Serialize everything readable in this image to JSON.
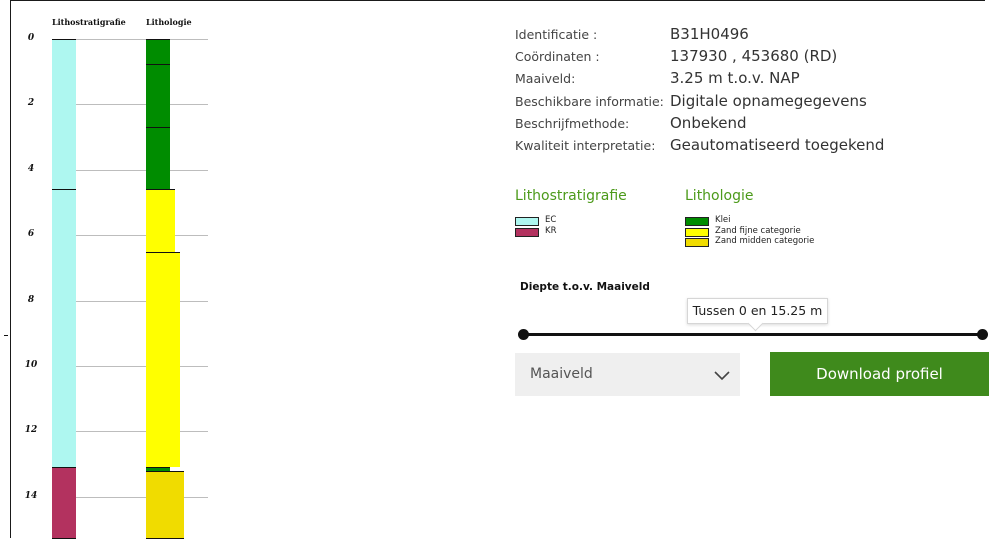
{
  "profile": {
    "columns": {
      "lithostratigrafie": "Lithostratigrafie",
      "lithologie": "Lithologie"
    },
    "depth_labels": [
      "0",
      "2",
      "4",
      "6",
      "8",
      "10",
      "12",
      "14"
    ],
    "unit_depth_range": [
      0,
      15.25
    ],
    "lithostratigrafie_layers": [
      {
        "code": "EC",
        "top": 0,
        "bottom": 4.6,
        "color": "#aef7f0"
      },
      {
        "code": "KR",
        "top": 13.1,
        "bottom": 15.25,
        "color": "#b3325f"
      }
    ],
    "lithologie_layers": [
      {
        "type": "Klei",
        "top": 0,
        "bottom": 4.6,
        "color": "#008c00"
      },
      {
        "type": "Zand fijne categorie",
        "top": 4.6,
        "bottom": 6.5,
        "color": "#ffff00"
      },
      {
        "type": "Zand fijne categorie",
        "top": 6.5,
        "bottom": 13.1,
        "color": "#ffff00"
      },
      {
        "type": "Klei",
        "top": 13.1,
        "bottom": 13.2,
        "color": "#008c00"
      },
      {
        "type": "Zand midden categorie",
        "top": 13.2,
        "bottom": 15.25,
        "color": "#f0dc00"
      }
    ]
  },
  "info": {
    "rows": [
      {
        "label": "Identificatie :",
        "value": "B31H0496"
      },
      {
        "label": "Coördinaten :",
        "value": "137930 , 453680 (RD)"
      },
      {
        "label": "Maaiveld:",
        "value": "3.25 m t.o.v. NAP"
      },
      {
        "label": "Beschikbare informatie:",
        "value": "Digitale opnamegegevens"
      },
      {
        "label": "Beschrijfmethode:",
        "value": "Onbekend"
      },
      {
        "label": "Kwaliteit interpretatie:",
        "value": "Geautomatiseerd toegekend"
      }
    ]
  },
  "legend": {
    "lithostratigrafie_title": "Lithostratigrafie",
    "lithologie_title": "Lithologie",
    "lithostratigrafie_items": [
      {
        "label": "EC",
        "color": "#aef7f0"
      },
      {
        "label": "KR",
        "color": "#b3325f"
      }
    ],
    "lithologie_items": [
      {
        "label": "Klei",
        "color": "#008c00"
      },
      {
        "label": "Zand fijne categorie",
        "color": "#ffff00"
      },
      {
        "label": "Zand midden categorie",
        "color": "#f0dc00"
      }
    ]
  },
  "depth_filter": {
    "title": "Diepte t.o.v. Maaiveld",
    "tooltip": "Tussen 0 en 15.25 m",
    "range_value": [
      0,
      15.25
    ]
  },
  "select": {
    "value": "Maaiveld",
    "icon": "chevron-down-icon"
  },
  "download": {
    "label": "Download profiel"
  },
  "colors": {
    "accent_green": "#3f8a1c",
    "legend_title": "#4c9a1a"
  }
}
